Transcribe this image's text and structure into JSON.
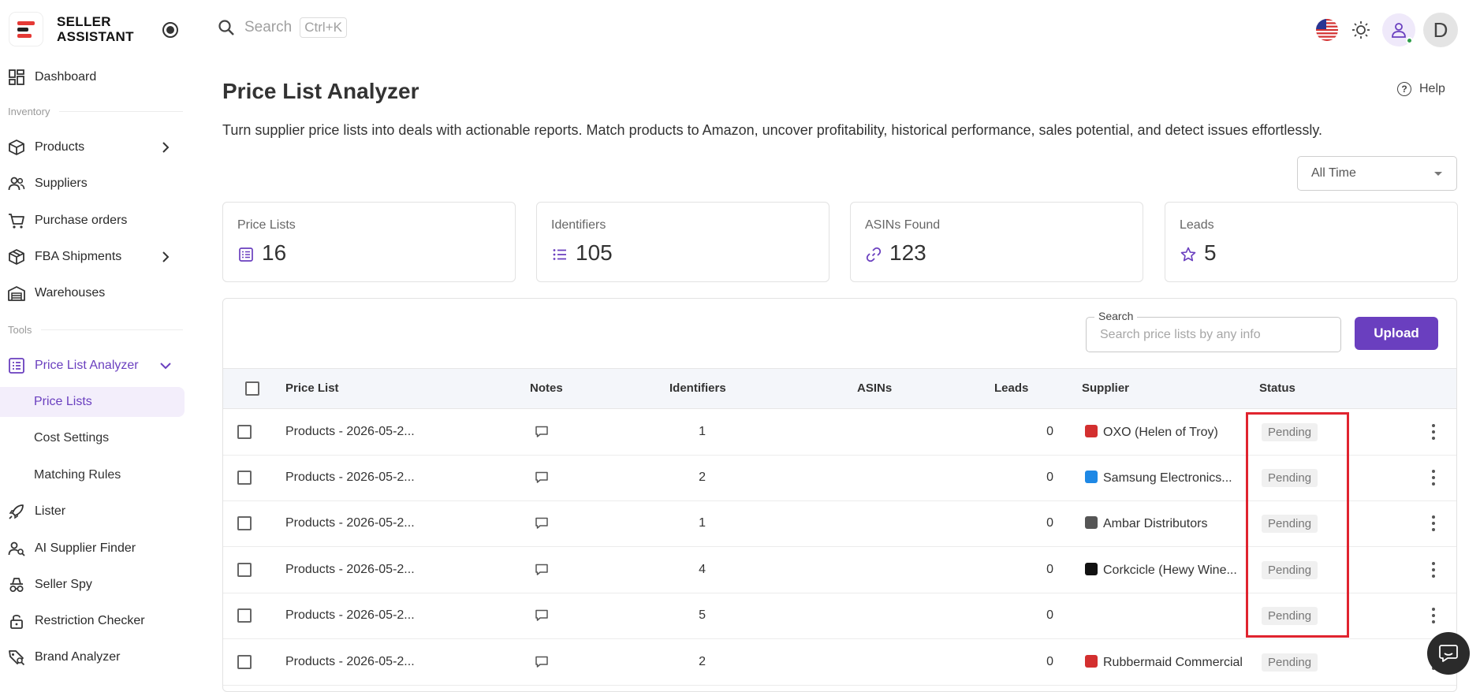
{
  "brand": {
    "line1": "SELLER",
    "line2": "ASSISTANT"
  },
  "sidebar": {
    "dashboard": "Dashboard",
    "inventory_section": "Inventory",
    "products": "Products",
    "suppliers": "Suppliers",
    "purchase_orders": "Purchase orders",
    "fba_shipments": "FBA Shipments",
    "warehouses": "Warehouses",
    "tools_section": "Tools",
    "price_list_analyzer": "Price List Analyzer",
    "price_lists": "Price Lists",
    "cost_settings": "Cost Settings",
    "matching_rules": "Matching Rules",
    "lister": "Lister",
    "ai_supplier_finder": "AI Supplier Finder",
    "seller_spy": "Seller Spy",
    "restriction_checker": "Restriction Checker",
    "brand_analyzer": "Brand Analyzer"
  },
  "topbar": {
    "search_placeholder": "Search",
    "shortcut": "Ctrl+K",
    "avatar_initial": "D"
  },
  "page": {
    "title": "Price List Analyzer",
    "help": "Help",
    "description": "Turn supplier price lists into deals with actionable reports. Match products to Amazon, uncover profitability, historical performance, sales potential, and detect issues effortlessly.",
    "period": "All Time"
  },
  "stats": [
    {
      "label": "Price Lists",
      "value": "16"
    },
    {
      "label": "Identifiers",
      "value": "105"
    },
    {
      "label": "ASINs Found",
      "value": "123"
    },
    {
      "label": "Leads",
      "value": "5"
    }
  ],
  "table": {
    "search_legend": "Search",
    "search_placeholder": "Search price lists by any info",
    "upload_label": "Upload",
    "columns": [
      "Price List",
      "Notes",
      "Identifiers",
      "ASINs",
      "Leads",
      "Supplier",
      "Status"
    ],
    "rows": [
      {
        "name": "Products - 2026-05-2...",
        "identifiers": "1",
        "asins": "",
        "leads": "0",
        "supplier": "OXO (Helen of Troy)",
        "supplier_icon": "oxo-logo-icon",
        "icon_color": "#d32f2f",
        "status": "Pending"
      },
      {
        "name": "Products - 2026-05-2...",
        "identifiers": "2",
        "asins": "",
        "leads": "0",
        "supplier": "Samsung Electronics...",
        "supplier_icon": "samsung-logo-icon",
        "icon_color": "#1e88e5",
        "status": "Pending"
      },
      {
        "name": "Products - 2026-05-2...",
        "identifiers": "1",
        "asins": "",
        "leads": "0",
        "supplier": "Ambar Distributors",
        "supplier_icon": "ambar-logo-icon",
        "icon_color": "#555555",
        "status": "Pending"
      },
      {
        "name": "Products - 2026-05-2...",
        "identifiers": "4",
        "asins": "",
        "leads": "0",
        "supplier": "Corkcicle (Hewy Wine...",
        "supplier_icon": "corkcicle-logo-icon",
        "icon_color": "#111111",
        "status": "Pending"
      },
      {
        "name": "Products - 2026-05-2...",
        "identifiers": "5",
        "asins": "",
        "leads": "0",
        "supplier": "",
        "supplier_icon": "",
        "icon_color": "",
        "status": "Pending"
      },
      {
        "name": "Products - 2026-05-2...",
        "identifiers": "2",
        "asins": "",
        "leads": "0",
        "supplier": "Rubbermaid Commercial",
        "supplier_icon": "rubbermaid-logo-icon",
        "icon_color": "#d32f2f",
        "status": "Pending"
      }
    ]
  },
  "colors": {
    "accent": "#6a3fbf",
    "highlight": "#e0242f"
  }
}
